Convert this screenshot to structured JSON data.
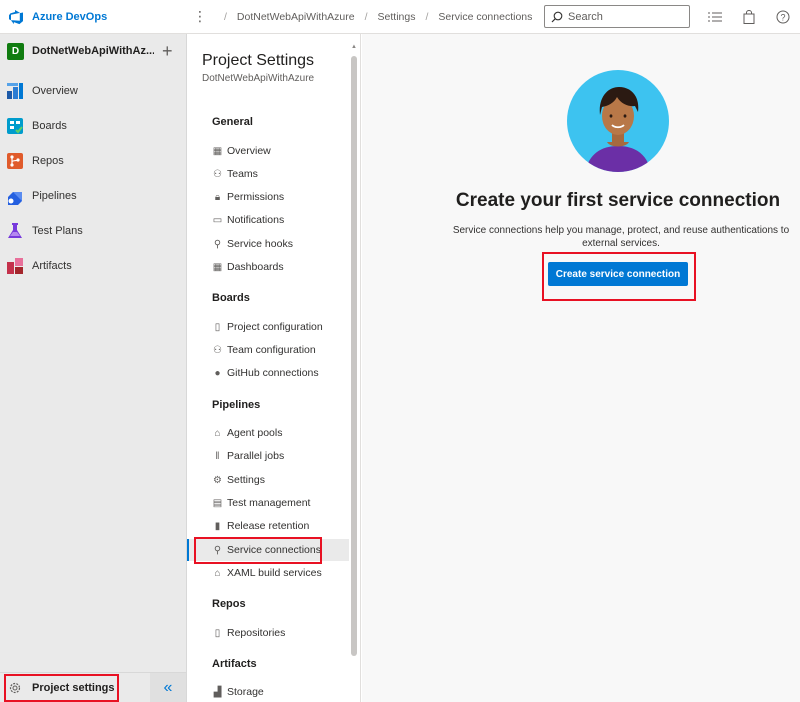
{
  "header": {
    "brand": "Azure DevOps",
    "breadcrumbs": [
      "DotNetWebApiWithAzure",
      "Settings",
      "Service connections"
    ],
    "search_placeholder": "Search"
  },
  "leftnav": {
    "project_initial": "D",
    "project_name": "DotNetWebApiWithAz...",
    "items": [
      {
        "label": "Overview",
        "icon": "overview-icon"
      },
      {
        "label": "Boards",
        "icon": "boards-icon"
      },
      {
        "label": "Repos",
        "icon": "repos-icon"
      },
      {
        "label": "Pipelines",
        "icon": "pipelines-icon"
      },
      {
        "label": "Test Plans",
        "icon": "test-plans-icon"
      },
      {
        "label": "Artifacts",
        "icon": "artifacts-icon"
      }
    ],
    "project_settings_label": "Project settings"
  },
  "settings": {
    "title": "Project Settings",
    "subtitle": "DotNetWebApiWithAzure",
    "sections": [
      {
        "heading": "General",
        "items": [
          "Overview",
          "Teams",
          "Permissions",
          "Notifications",
          "Service hooks",
          "Dashboards"
        ]
      },
      {
        "heading": "Boards",
        "items": [
          "Project configuration",
          "Team configuration",
          "GitHub connections"
        ]
      },
      {
        "heading": "Pipelines",
        "items": [
          "Agent pools",
          "Parallel jobs",
          "Settings",
          "Test management",
          "Release retention",
          "Service connections",
          "XAML build services"
        ]
      },
      {
        "heading": "Repos",
        "items": [
          "Repositories"
        ]
      },
      {
        "heading": "Artifacts",
        "items": [
          "Storage"
        ]
      }
    ],
    "selected_item": "Service connections"
  },
  "main": {
    "title": "Create your first service connection",
    "description": "Service connections help you manage, protect, and reuse authentications to external services.",
    "create_button": "Create service connection"
  },
  "colors": {
    "accent": "#0078d4",
    "highlight": "#e81123",
    "project_avatar": "#107c10"
  }
}
